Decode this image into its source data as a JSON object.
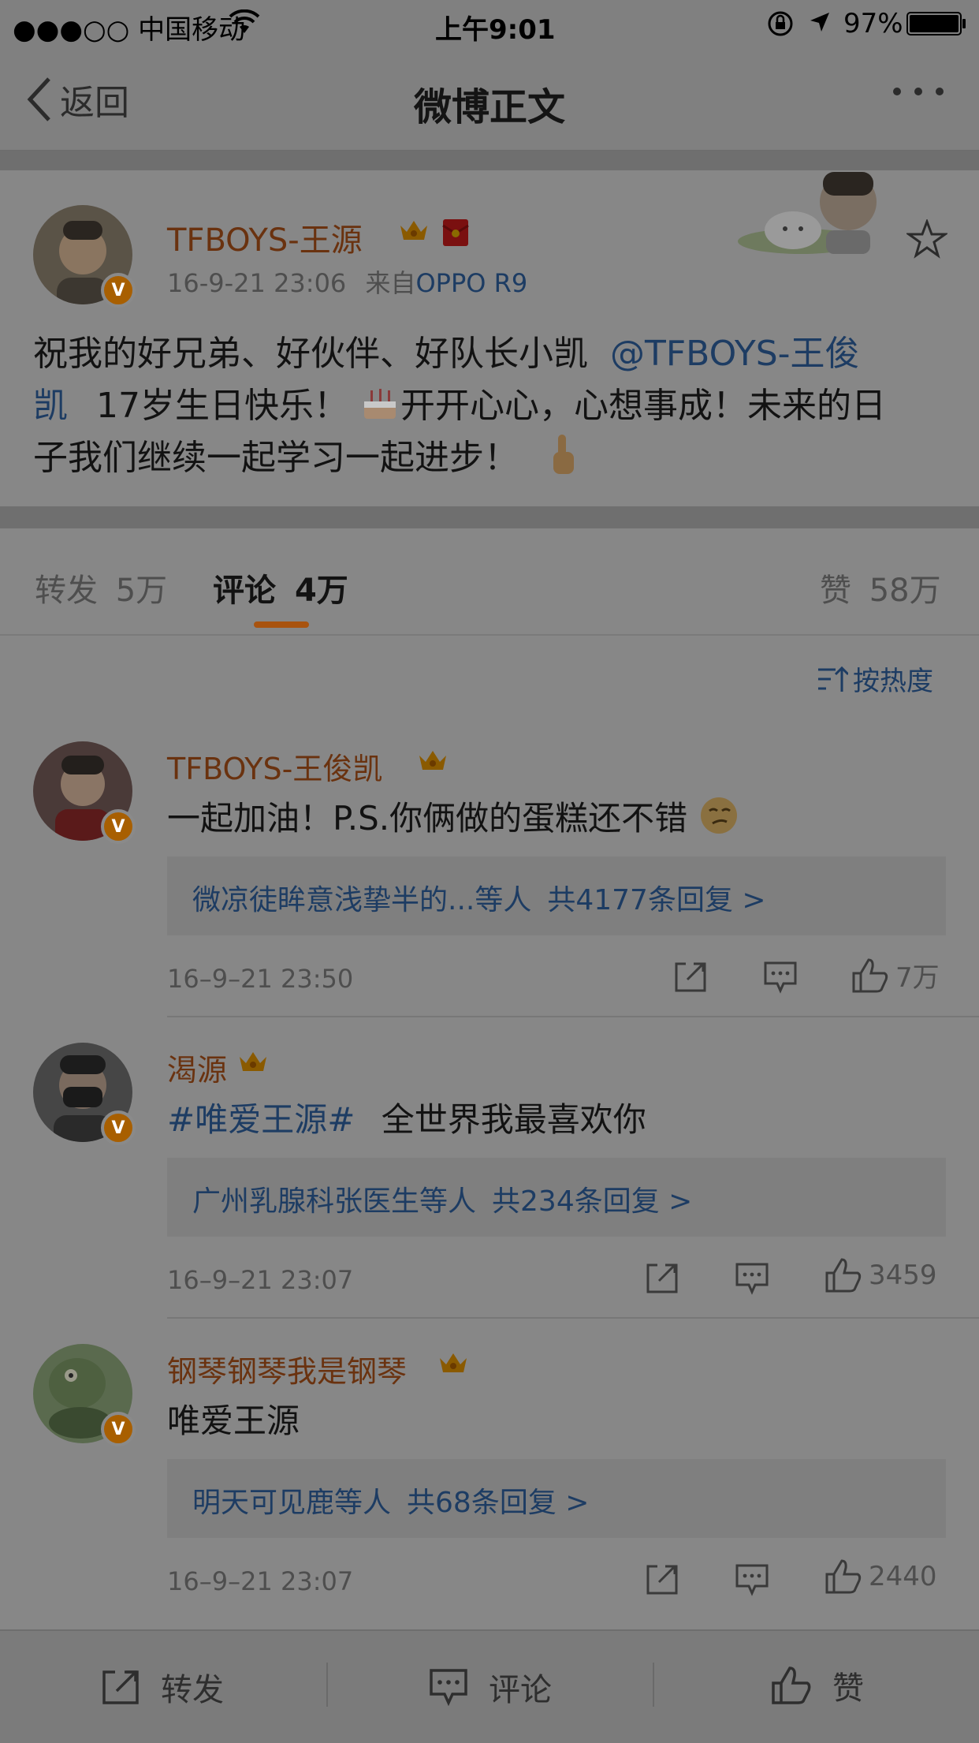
{
  "status": {
    "carrier": "●●●○○ 中国移动",
    "time": "上午9:01",
    "battery": "97%"
  },
  "nav": {
    "back_label": "返回",
    "title": "微博正文",
    "more_label": "···"
  },
  "post": {
    "author": "TFBOYS-王源",
    "datetime": "16-9-21 23:06",
    "source_prefix": "来自",
    "source": "OPPO R9",
    "text_line1": "祝我的好兄弟、好伙伴、好队长小凯",
    "mention_part1": "@TFBOYS-王俊",
    "mention_part2": "凯",
    "text_line2": "17岁生日快乐！",
    "text_line2b": "开开心心，心想事成！未来的日",
    "text_line3": "子我们继续一起学习一起进步！"
  },
  "tabs": {
    "repost_label": "转发",
    "repost_count": "5万",
    "comment_label": "评论",
    "comment_count": "4万",
    "like_label": "赞",
    "like_count": "58万"
  },
  "sort": {
    "label": "按热度"
  },
  "comments": [
    {
      "author": "TFBOYS-王俊凯",
      "text": "一起加油！P.S.你俩做的蛋糕还不错",
      "reply_names": "微凉徒眸意浅挚半的...等人",
      "reply_count": "共4177条回复 >",
      "time": "16–9–21 23:50",
      "likes": "7万"
    },
    {
      "author": "渴源",
      "hashtag": "#唯爱王源#",
      "text": "全世界我最喜欢你",
      "reply_names": "广州乳腺科张医生等人",
      "reply_count": "共234条回复 >",
      "time": "16–9–21 23:07",
      "likes": "3459"
    },
    {
      "author": "钢琴钢琴我是钢琴",
      "text": "唯爱王源",
      "reply_names": "明天可见鹿等人",
      "reply_count": "共68条回复 >",
      "time": "16–9–21 23:07",
      "likes": "2440"
    }
  ],
  "bottom": {
    "repost": "转发",
    "comment": "评论",
    "like": "赞"
  },
  "colors": {
    "overlay_bg": "#808080",
    "username_orange": "#6a320f",
    "link_blue": "#1d3c63",
    "tab_underline": "#a8530f"
  }
}
